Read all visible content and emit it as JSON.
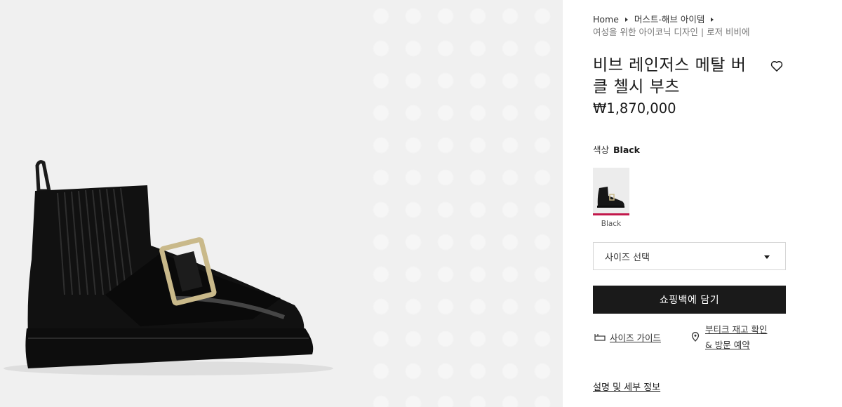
{
  "breadcrumb": {
    "items": [
      "Home",
      "머스트-해브 아이템"
    ],
    "current": "여성을 위한 아이코닉 디자인 | 로저 비비에"
  },
  "product": {
    "title": "비브 레인저스 메탈 버클 첼시 부츠",
    "price": "₩1,870,000",
    "image_icon": "black-chelsea-boot-photo"
  },
  "color": {
    "label": "색상",
    "value": "Black",
    "swatches": [
      {
        "label": "Black",
        "selected": true
      }
    ],
    "selected_accent": "#c2184b"
  },
  "size": {
    "placeholder": "사이즈 선택"
  },
  "actions": {
    "add_to_bag": "쇼핑백에 담기",
    "size_guide": "사이즈 가이드",
    "boutique_line1": "부티크 재고 확인",
    "boutique_line2": "& 방문 예약",
    "description": "설명 및 세부 정보"
  },
  "icons": {
    "wishlist": "heart-outline-icon",
    "size_guide": "ruler-icon",
    "boutique": "location-pin-icon",
    "dropdown": "caret-down-icon"
  },
  "colors": {
    "primary_button": "#1a1a1a",
    "gallery_background": "#f0f0f0"
  }
}
